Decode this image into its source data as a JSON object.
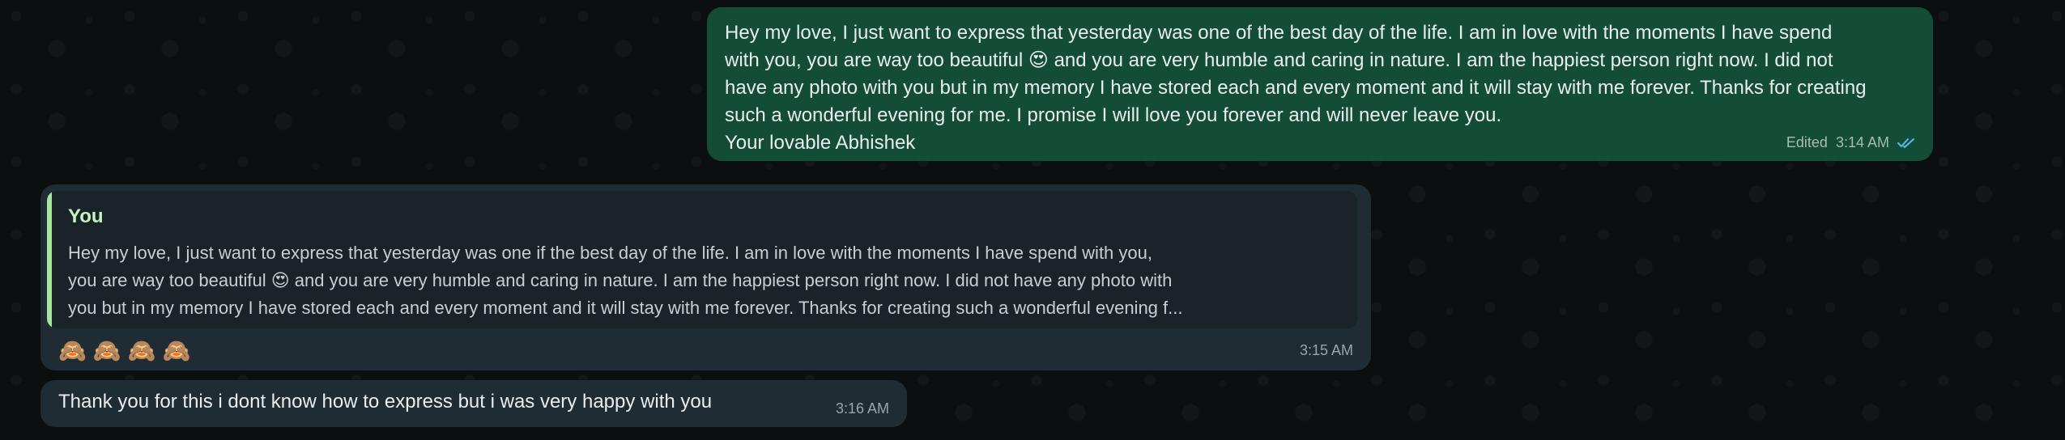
{
  "outgoing_message": {
    "text": "Hey my love, I just want to express that yesterday was one of the best day of the life. I am in love with the moments I have spend\nwith you, you are way too beautiful 😍 and you are very humble and caring in nature. I am the happiest person right now. I did not\nhave any photo with you but in my memory I have stored each and every moment and it will stay with me forever. Thanks for creating\nsuch a wonderful evening for me. I promise I will love you forever and will never leave you.\nYour lovable Abhishek",
    "edited_label": "Edited",
    "time": "3:14 AM",
    "read_status_icon": "double-check-icon",
    "colors": {
      "bubble": "#144d37",
      "check": "#53bdeb"
    }
  },
  "incoming_reply": {
    "quote_author": "You",
    "quote_text": "Hey my love, I just want to express that yesterday was one if the best day of the life. I am in love with the moments I have spend with you,\nyou are way too beautiful 😍 and you are very humble and caring in nature. I am the happiest person right now. I did not have any photo with\nyou but in my memory I have stored each and every moment and it will stay with me forever. Thanks for creating such a wonderful evening f...",
    "emojis": "🙈🙈🙈🙈",
    "time": "3:15 AM",
    "colors": {
      "bubble": "#202c33",
      "quote_bar": "#a8e6a0"
    }
  },
  "incoming_message": {
    "text": "Thank you for this i dont know how to express but i was very happy with you",
    "time": "3:16 AM"
  }
}
